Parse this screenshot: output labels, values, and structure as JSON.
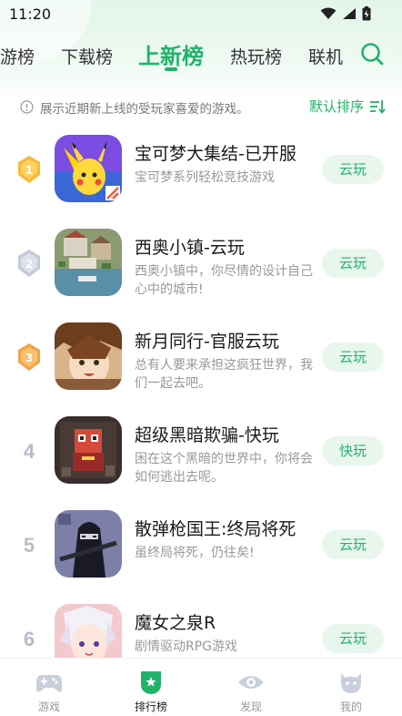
{
  "status": {
    "time": "11:20"
  },
  "tabs": [
    {
      "label": "游榜"
    },
    {
      "label": "下载榜"
    },
    {
      "label": "上新榜"
    },
    {
      "label": "热玩榜"
    },
    {
      "label": "联机"
    }
  ],
  "notice": {
    "text": "展示近期新上线的受玩家喜爱的游戏。",
    "sort_label": "默认排序"
  },
  "games": [
    {
      "rank": "1",
      "title": "宝可梦大集结-已开服",
      "desc": "宝可梦系列轻松竞技游戏",
      "button": "云玩"
    },
    {
      "rank": "2",
      "title": "西奥小镇-云玩",
      "desc": "西奥小镇中，你尽情的设计自己心中的城市!",
      "button": "云玩"
    },
    {
      "rank": "3",
      "title": "新月同行-官服云玩",
      "desc": "总有人要来承担这疯狂世界，我们一起去吧。",
      "button": "云玩"
    },
    {
      "rank": "4",
      "title": "超级黑暗欺骗-快玩",
      "desc": "困在这个黑暗的世界中，你将会如何逃出去呢。",
      "button": "快玩"
    },
    {
      "rank": "5",
      "title": "散弹枪国王:终局将死",
      "desc": "虽终局将死，仍往矣!",
      "button": "云玩"
    },
    {
      "rank": "6",
      "title": "魔女之泉R",
      "desc": "剧情驱动RPG游戏",
      "button": "云玩"
    }
  ],
  "bottom_nav": [
    {
      "label": "游戏"
    },
    {
      "label": "排行榜"
    },
    {
      "label": "发现"
    },
    {
      "label": "我的"
    }
  ],
  "colors": {
    "accent": "#22b36a",
    "gold_badge": "#f5b93a",
    "silver_badge": "#c5cad6",
    "muted": "#999999"
  }
}
